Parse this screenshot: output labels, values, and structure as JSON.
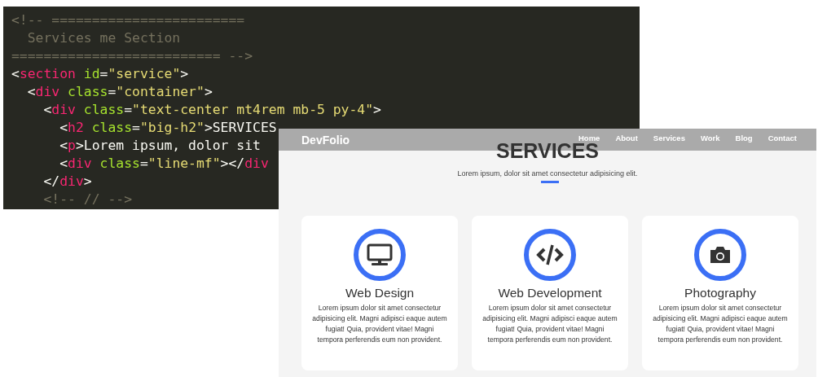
{
  "editor": {
    "lines": [
      [
        {
          "kind": "comment",
          "text": "<!-- ========================"
        }
      ],
      [
        {
          "kind": "comment",
          "text": "  Services me Section"
        }
      ],
      [
        {
          "kind": "comment",
          "text": "========================== -->"
        }
      ],
      [
        {
          "kind": "punct",
          "text": "<"
        },
        {
          "kind": "tag",
          "text": "section"
        },
        {
          "kind": "attr",
          "text": " id"
        },
        {
          "kind": "punct",
          "text": "="
        },
        {
          "kind": "string",
          "text": "\"service\""
        },
        {
          "kind": "punct",
          "text": ">"
        }
      ],
      [
        {
          "kind": "punct",
          "text": "  <"
        },
        {
          "kind": "tag",
          "text": "div"
        },
        {
          "kind": "attr",
          "text": " class"
        },
        {
          "kind": "punct",
          "text": "="
        },
        {
          "kind": "string",
          "text": "\"container\""
        },
        {
          "kind": "punct",
          "text": ">"
        }
      ],
      [
        {
          "kind": "punct",
          "text": "    <"
        },
        {
          "kind": "tag",
          "text": "div"
        },
        {
          "kind": "attr",
          "text": " class"
        },
        {
          "kind": "punct",
          "text": "="
        },
        {
          "kind": "string",
          "text": "\"text-center mt4rem mb-5 py-4\""
        },
        {
          "kind": "punct",
          "text": ">"
        }
      ],
      [
        {
          "kind": "punct",
          "text": "      <"
        },
        {
          "kind": "tag",
          "text": "h2"
        },
        {
          "kind": "attr",
          "text": " class"
        },
        {
          "kind": "punct",
          "text": "="
        },
        {
          "kind": "string",
          "text": "\"big-h2\""
        },
        {
          "kind": "punct",
          "text": ">SERVICES"
        }
      ],
      [
        {
          "kind": "punct",
          "text": "      <"
        },
        {
          "kind": "tag",
          "text": "p"
        },
        {
          "kind": "punct",
          "text": ">Lorem ipsum, dolor sit"
        }
      ],
      [
        {
          "kind": "punct",
          "text": "      <"
        },
        {
          "kind": "tag",
          "text": "div"
        },
        {
          "kind": "attr",
          "text": " class"
        },
        {
          "kind": "punct",
          "text": "="
        },
        {
          "kind": "string",
          "text": "\"line-mf\""
        },
        {
          "kind": "punct",
          "text": "></"
        },
        {
          "kind": "tag",
          "text": "div"
        }
      ],
      [
        {
          "kind": "punct",
          "text": "    </"
        },
        {
          "kind": "tag",
          "text": "div"
        },
        {
          "kind": "punct",
          "text": ">"
        }
      ],
      [
        {
          "kind": "comment",
          "text": "    <!-- // -->"
        }
      ]
    ]
  },
  "website": {
    "brand": "DevFolio",
    "nav": [
      "Home",
      "About",
      "Services",
      "Work",
      "Blog",
      "Contact"
    ],
    "heading": "SERVICES",
    "subtitle": "Lorem ipsum, dolor sit amet consectetur adipisicing elit.",
    "cards": [
      {
        "title": "Web Design",
        "text": "Lorem ipsum dolor sit amet consectetur adipisicing elit. Magni adipisci eaque autem fugiat! Quia, provident vitae! Magni tempora perferendis eum non provident."
      },
      {
        "title": "Web Development",
        "text": "Lorem ipsum dolor sit amet consectetur adipisicing elit. Magni adipisci eaque autem fugiat! Quia, provident vitae! Magni tempora perferendis eum non provident."
      },
      {
        "title": "Photography",
        "text": "Lorem ipsum dolor sit amet consectetur adipisicing elit. Magni adipisci eaque autem fugiat! Quia, provident vitae! Magni tempora perferendis eum non provident."
      }
    ]
  }
}
